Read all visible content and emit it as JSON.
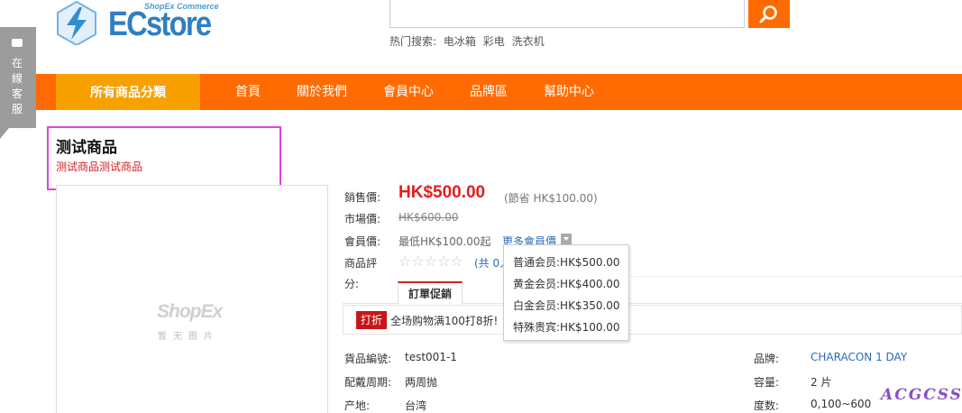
{
  "header": {
    "logo_sub": "ShopEx Commerce",
    "logo_name": "ECstore",
    "search_placeholder": "",
    "hot_search_label": "热门搜索:",
    "hot_search_terms": [
      "电冰箱",
      "彩电",
      "洗衣机"
    ]
  },
  "side_tab": {
    "label": "在線客服"
  },
  "nav": {
    "all_categories": "所有商品分類",
    "items": [
      "首頁",
      "關於我們",
      "會員中心",
      "品牌區",
      "幫助中心"
    ]
  },
  "product": {
    "title": "测试商品",
    "subtitle": "测试商品测试商品",
    "image_logo": "ShopEx",
    "image_caption": "暂无图片",
    "sale_price_label": "銷售價:",
    "sale_price": "HK$500.00",
    "save_text_prefix": "(節省 ",
    "save_amount": "HK$100.00",
    "save_text_suffix": ")",
    "market_price_label": "市場價:",
    "market_price": "HK$600.00",
    "member_price_label": "會員價:",
    "member_price_value": "最低HK$100.00起",
    "more_member_price": "更多會員價",
    "review_label": "商品評",
    "review_label_2": "分:",
    "review_count": "(共 0人",
    "promo_tab": "訂單促銷",
    "promo_tag": "打折",
    "promo_text": "全场购物满100打8折!",
    "member_prices": [
      "普通会员:HK$500.00",
      "黄金会员:HK$400.00",
      "白金会员:HK$350.00",
      "特殊贵宾:HK$100.00"
    ],
    "specs_left": [
      {
        "label": "貨品編號:",
        "value": "test001-1"
      },
      {
        "label": "配戴周期:",
        "value": "两周抛"
      },
      {
        "label": "产地:",
        "value": "台湾"
      }
    ],
    "specs_right": [
      {
        "label": "品牌:",
        "value": "CHARACON 1 DAY"
      },
      {
        "label": "容量:",
        "value": "2 片"
      },
      {
        "label": "度数:",
        "value": "0,100~600"
      }
    ]
  },
  "watermark": "ACGCSS",
  "colors": {
    "accent": "#ff6b00",
    "nav_highlight": "#f7a000",
    "price": "#e31e1e",
    "link": "#2a6cb7"
  }
}
